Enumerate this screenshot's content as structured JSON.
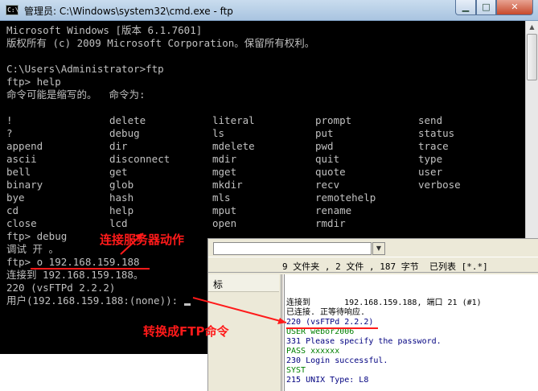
{
  "window": {
    "title": "管理员: C:\\Windows\\system32\\cmd.exe - ftp",
    "title_icon": "C:\\",
    "min_glyph": "▁",
    "max_glyph": "□",
    "close_glyph": "✕"
  },
  "console": {
    "lines_top": [
      "Microsoft Windows [版本 6.1.7601]",
      "版权所有 (c) 2009 Microsoft Corporation。保留所有权利。",
      "",
      "C:\\Users\\Administrator>ftp",
      "ftp> help",
      "命令可能是缩写的。  命令为:"
    ],
    "command_columns": [
      [
        "!",
        "?",
        "append",
        "ascii",
        "bell",
        "binary",
        "bye",
        "cd",
        "close"
      ],
      [
        "delete",
        "debug",
        "dir",
        "disconnect",
        "get",
        "glob",
        "hash",
        "help",
        "lcd"
      ],
      [
        "literal",
        "ls",
        "mdelete",
        "mdir",
        "mget",
        "mkdir",
        "mls",
        "mput",
        "open"
      ],
      [
        "prompt",
        "put",
        "pwd",
        "quit",
        "quote",
        "recv",
        "remotehelp",
        "rename",
        "rmdir"
      ],
      [
        "send",
        "status",
        "trace",
        "type",
        "user",
        "verbose"
      ]
    ],
    "lines_bottom": [
      "ftp> debug",
      "调试 开 。",
      "ftp> o 192.168.159.188",
      "连接到 192.168.159.188。",
      "220 (vsFTPd 2.2.2)",
      "用户(192.168.159.188:(none)): "
    ]
  },
  "ftp_client": {
    "status": "9 文件夹 , 2 文件 , 187 字节  已列表 [*.*]",
    "left_header": "标",
    "log": [
      {
        "text": "连接到       192.168.159.188, 端口 21 (#1)",
        "color": "#000000"
      },
      {
        "text": "已连接. 正等待响应.",
        "color": "#000000"
      },
      {
        "text": "220 (vsFTPd 2.2.2)",
        "color": "#000080"
      },
      {
        "text": "USER webor2006",
        "color": "#008000"
      },
      {
        "text": "331 Please specify the password.",
        "color": "#000080"
      },
      {
        "text": "PASS xxxxxx",
        "color": "#008000"
      },
      {
        "text": "230 Login successful.",
        "color": "#000080"
      },
      {
        "text": "SYST",
        "color": "#008000"
      },
      {
        "text": "215 UNIX Type: L8",
        "color": "#000080"
      }
    ]
  },
  "annotations": {
    "connect_label": "连接服务器动作",
    "convert_label": "转换成FTP命令"
  },
  "colors": {
    "console_bg": "#000000",
    "console_fg": "#c0c0c0",
    "annotation": "#ff1a1a"
  }
}
